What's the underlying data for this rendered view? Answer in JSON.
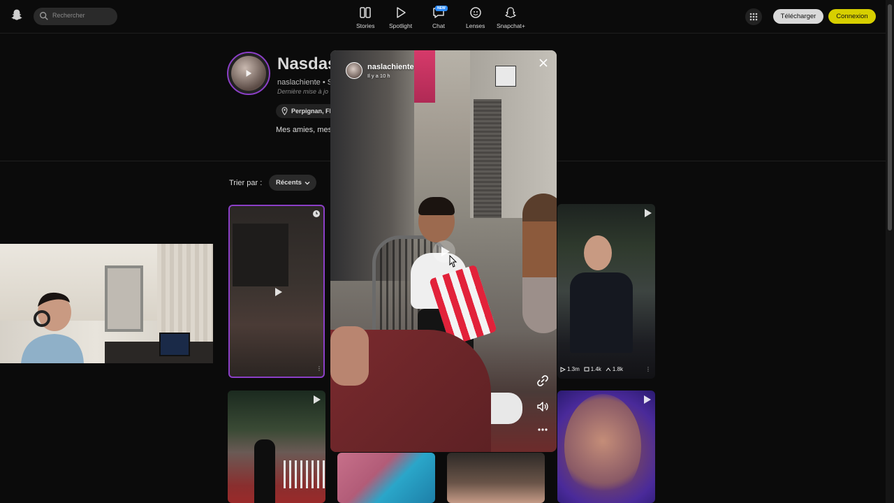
{
  "topbar": {
    "search_placeholder": "Rechercher",
    "nav": [
      {
        "label": "Stories",
        "icon": "stories-icon"
      },
      {
        "label": "Spotlight",
        "icon": "spotlight-play-icon"
      },
      {
        "label": "Chat",
        "icon": "chat-icon",
        "badge": "NEW"
      },
      {
        "label": "Lenses",
        "icon": "lenses-icon"
      },
      {
        "label": "Snapchat+",
        "icon": "snapchat-plus-icon"
      }
    ],
    "download_label": "Télécharger",
    "login_label": "Connexion",
    "accent_color": "#d7cf00"
  },
  "profile": {
    "display_name": "Nasdas",
    "username": "naslachiente • S",
    "updated": "Dernière mise à jo",
    "location": "Perpignan, Fl",
    "bio": "Mes amies, mes"
  },
  "sort": {
    "label": "Trier par :",
    "selected": "Récents"
  },
  "tiles": [
    {
      "type": "video",
      "active": true
    },
    {
      "type": "video",
      "stats": {
        "views": "1.3m",
        "comments": "1.4k",
        "shares": "1.8k"
      }
    },
    {
      "type": "video"
    },
    {
      "type": "video"
    },
    {
      "type": "video"
    },
    {
      "type": "video"
    }
  ],
  "story": {
    "username": "naslachiente",
    "time": "Il y a 10 h"
  },
  "colors": {
    "background": "#0b0b0b",
    "story_ring": "#8b3fc7",
    "new_badge": "#2d8cff"
  }
}
